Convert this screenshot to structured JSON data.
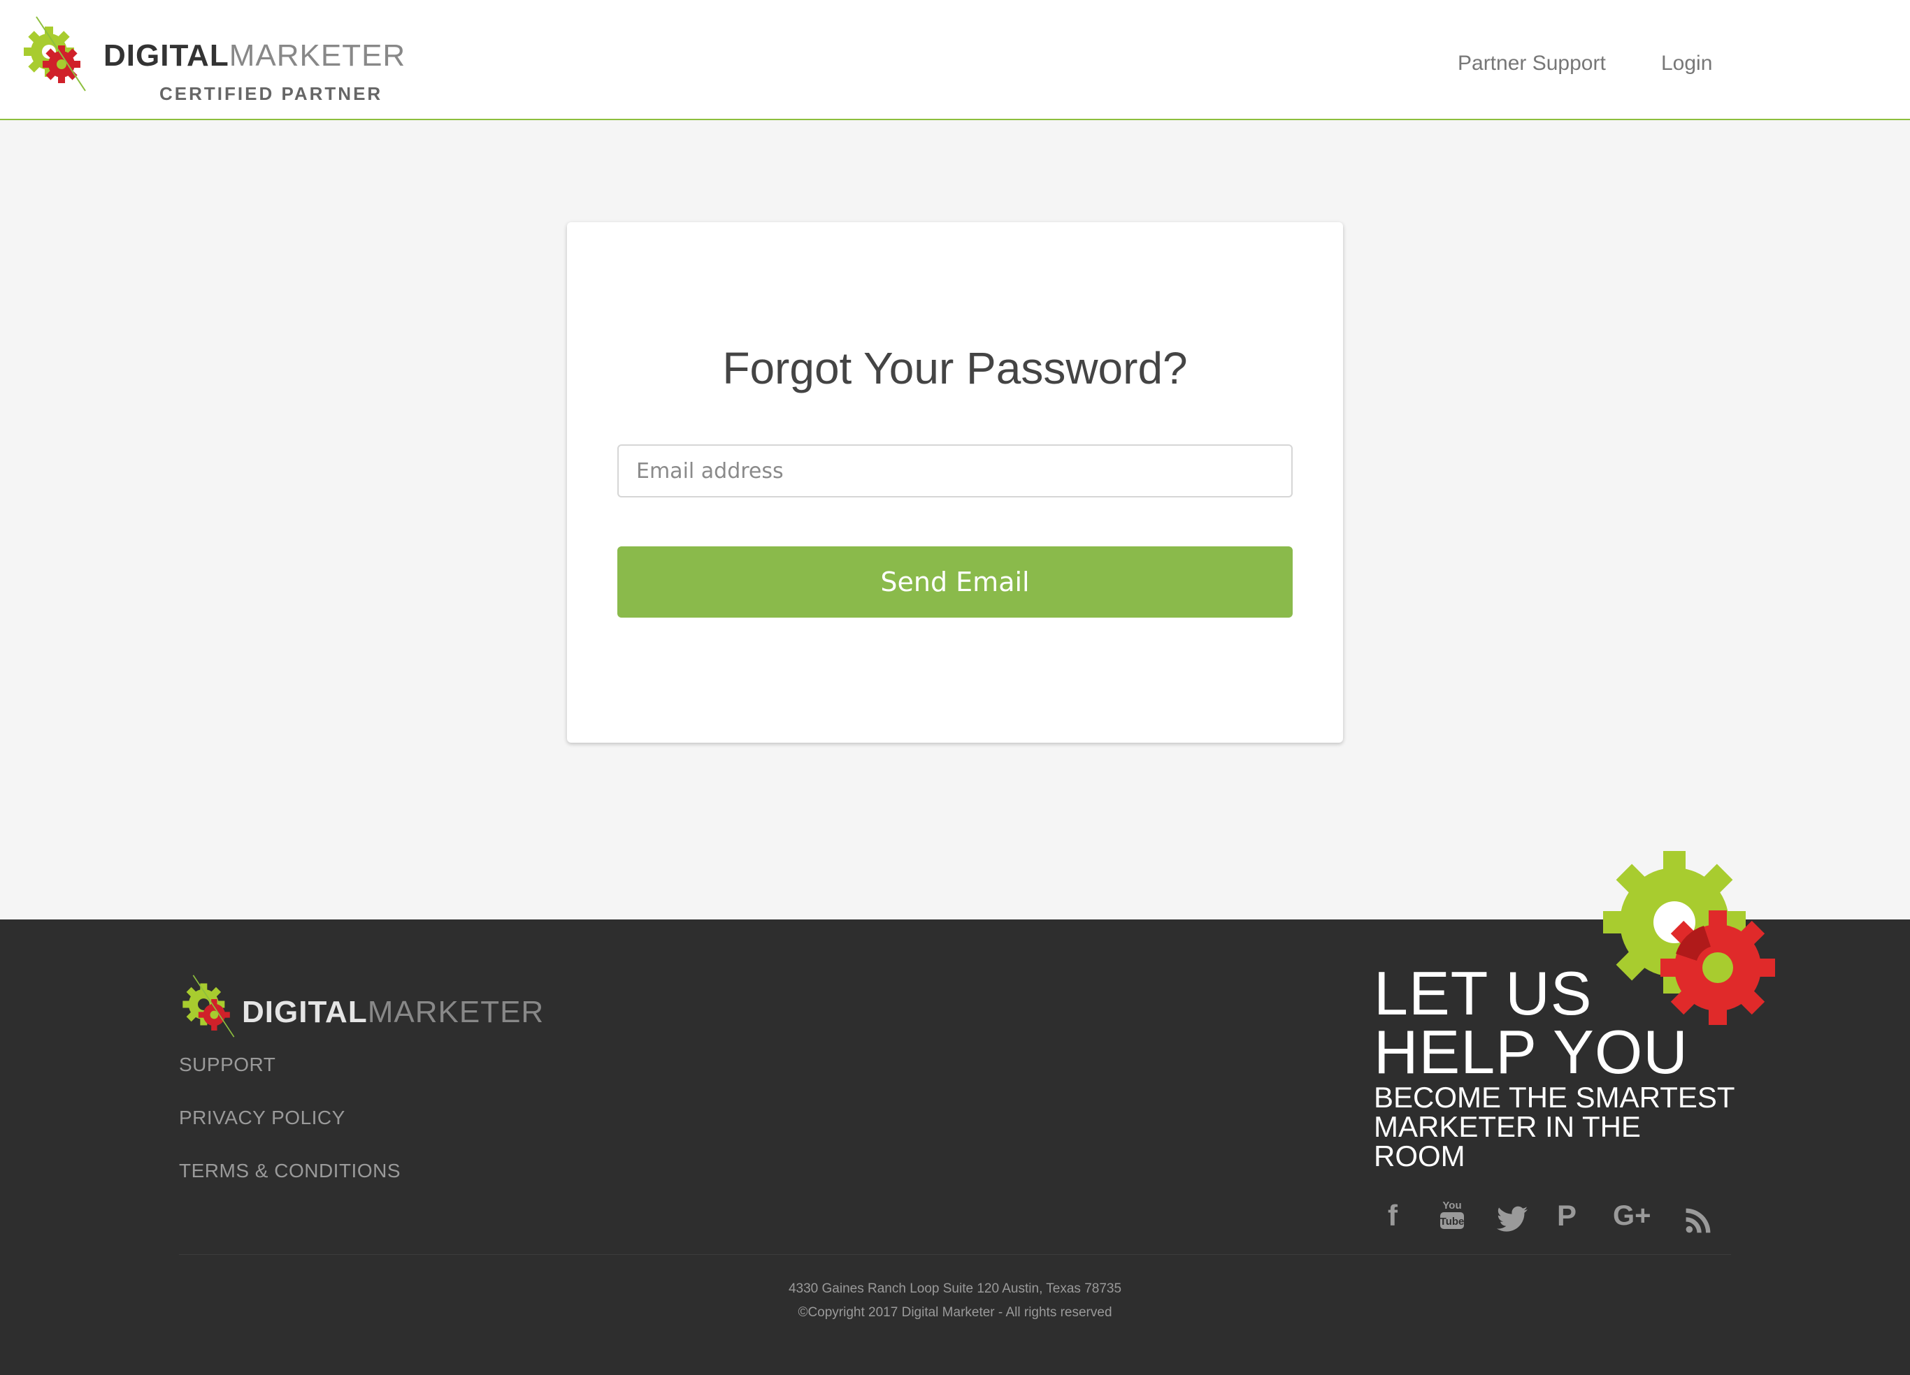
{
  "header": {
    "logo_bold": "DIGITAL",
    "logo_regular": "MARKETER",
    "logo_sub": "CERTIFIED PARTNER",
    "nav": {
      "support": "Partner Support",
      "login": "Login"
    }
  },
  "card": {
    "title": "Forgot Your Password?",
    "email_placeholder": "Email address",
    "email_value": "",
    "send_label": "Send Email"
  },
  "footer": {
    "logo_bold": "DIGITAL",
    "logo_regular": "MARKETER",
    "links": [
      "SUPPORT",
      "PRIVACY POLICY",
      "TERMS & CONDITIONS"
    ],
    "promo_large_1": "LET US",
    "promo_large_2": "HELP YOU",
    "promo_small": "BECOME THE SMARTEST MARKETER IN THE ROOM",
    "socials": [
      "facebook-icon",
      "youtube-icon",
      "twitter-icon",
      "pinterest-icon",
      "google-plus-icon",
      "rss-icon"
    ],
    "address": "4330 Gaines Ranch Loop Suite 120 Austin, Texas 78735",
    "copyright": "©Copyright 2017 Digital Marketer - All rights reserved"
  },
  "colors": {
    "accent_green": "#8aba4b",
    "gear_green": "#a8cc2f",
    "gear_red": "#e02a2a",
    "footer_bg": "#2e2e2e"
  }
}
